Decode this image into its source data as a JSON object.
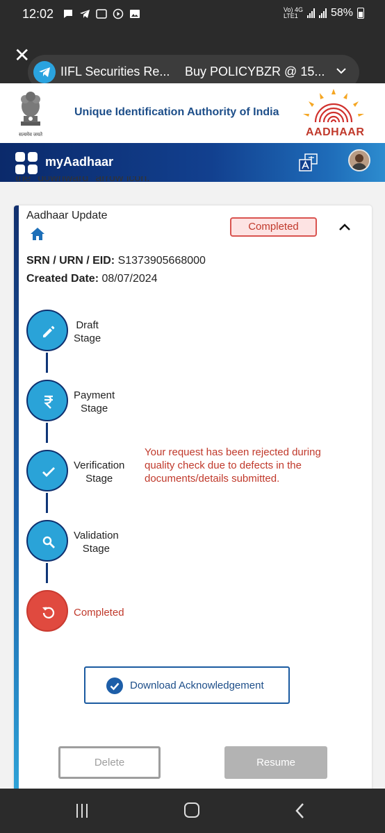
{
  "status_bar": {
    "time": "12:02",
    "network_label_top": "Vo) 4G",
    "network_label_bottom": "LTE1",
    "battery": "58%"
  },
  "notification": {
    "app_title": "IIFL Securities Re...",
    "message": "Buy POLICYBZR @ 15..."
  },
  "header": {
    "org_title": "Unique Identification Authority of India",
    "emblem_motto": "सत्यमेव जयते",
    "logo_word": "AADHAAR"
  },
  "appbar": {
    "title": "myAadhaar"
  },
  "content": {
    "cut_text": "the \"downward\" arrow icon.",
    "card": {
      "title": "Aadhaar Update",
      "status": "Completed",
      "srn_label": "SRN / URN / EID:",
      "srn_value": "S1373905668000",
      "date_label": "Created Date:",
      "date_value": "08/07/2024",
      "steps": [
        {
          "line1": "Draft",
          "line2": "Stage"
        },
        {
          "line1": "Payment",
          "line2": "Stage"
        },
        {
          "line1": "Verification",
          "line2": "Stage"
        },
        {
          "line1": "Validation",
          "line2": "Stage"
        },
        {
          "line1": "Completed"
        }
      ],
      "rejection_message": "Your request has been rejected during quality check due to defects in the documents/details submitted.",
      "ack_button": "Download Acknowledgement",
      "delete_button": "Delete",
      "resume_button": "Resume"
    }
  },
  "colors": {
    "accent_blue": "#2aa3d8",
    "dark_blue": "#0e2f6e",
    "error_red": "#c0392b",
    "completed_circle": "#e04a3f"
  }
}
